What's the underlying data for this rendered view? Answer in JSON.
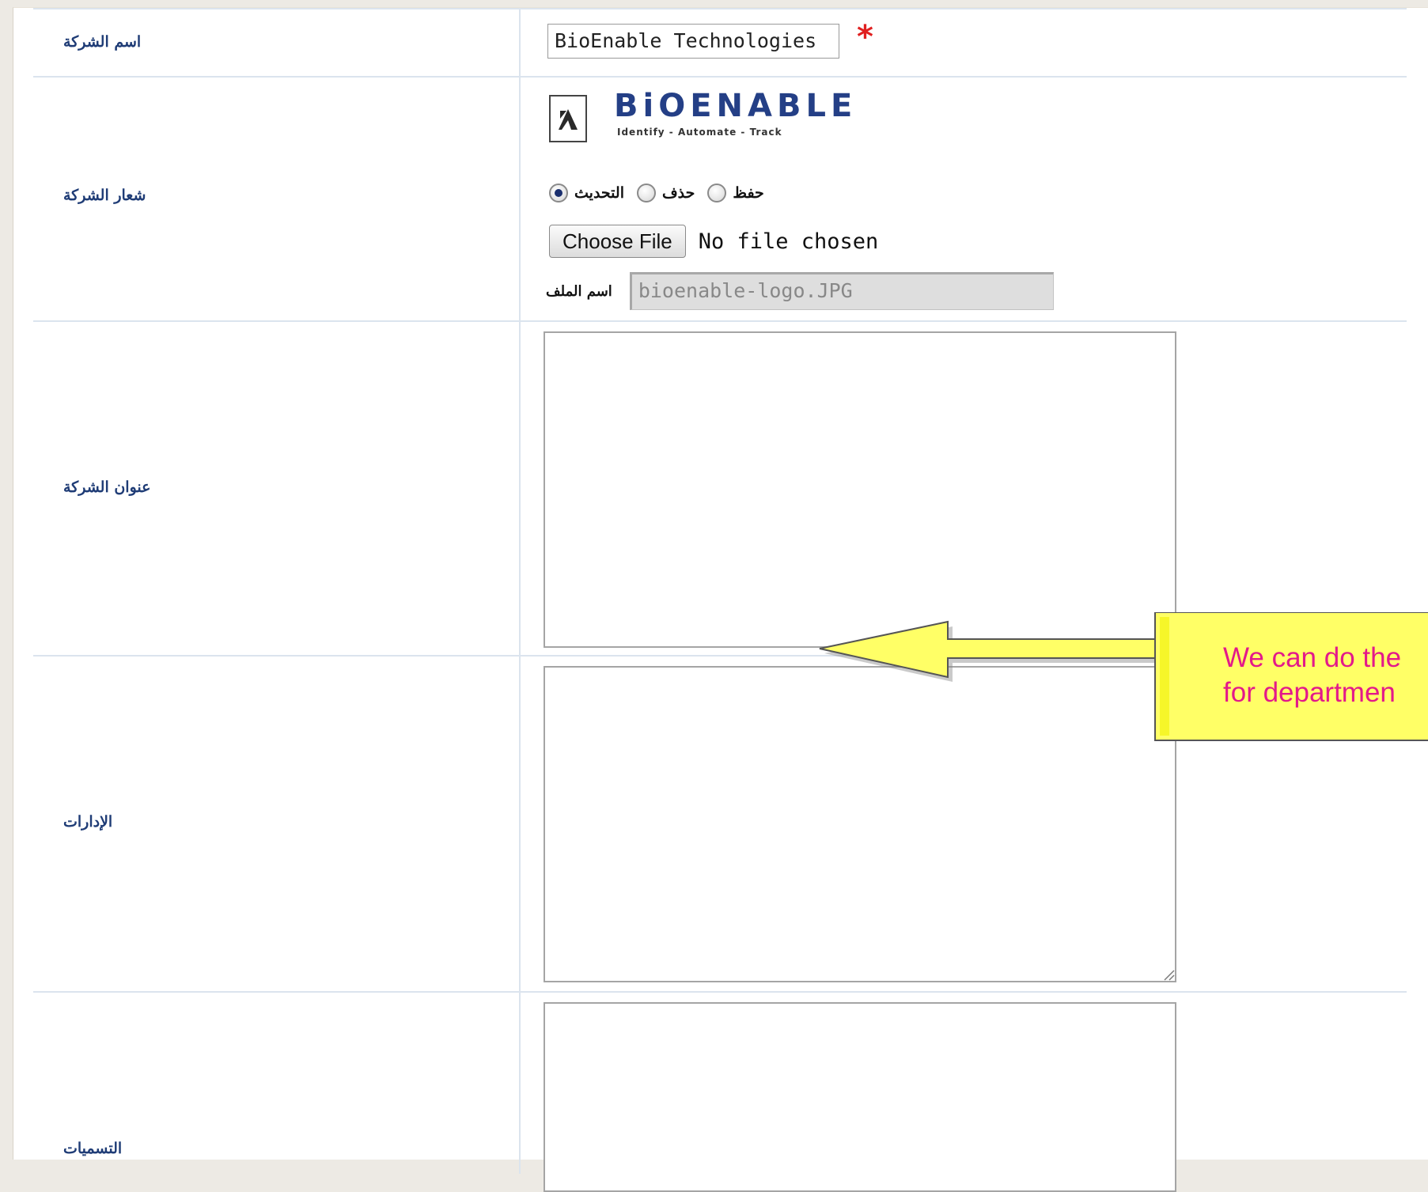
{
  "form": {
    "company_name": {
      "label": "اسم الشركة",
      "value": "BioEnable Technologies",
      "required_mark": "*"
    },
    "company_logo": {
      "label": "شعار الشركة",
      "logo": {
        "wordmark": "BiOENABLE",
        "tagline": "Identify - Automate - Track"
      },
      "radio_options": [
        {
          "label": "حفظ",
          "selected": false
        },
        {
          "label": "حذف",
          "selected": false
        },
        {
          "label": "التحديث",
          "selected": true
        }
      ],
      "choose_file_label": "Choose File",
      "no_file_text": "No file chosen",
      "file_name_label": "اسم الملف",
      "file_name_value": "bioenable-logo.JPG"
    },
    "company_address": {
      "label": "عنوان الشركة",
      "value": ""
    },
    "departments": {
      "label": "الإدارات",
      "value": ""
    },
    "designations": {
      "label": "التسميات",
      "value": ""
    }
  },
  "callout": {
    "lines": [
      "We can do the",
      "for departmen"
    ]
  },
  "colors": {
    "label_text": "#1f3c76",
    "required": "#e02020",
    "callout_fill": "#ffff66",
    "callout_text": "#e3198a",
    "row_border": "#dbe4ee"
  },
  "icons": {
    "required": "asterisk-icon",
    "resize": "resize-grip-icon",
    "arrow": "arrow-left-icon"
  }
}
